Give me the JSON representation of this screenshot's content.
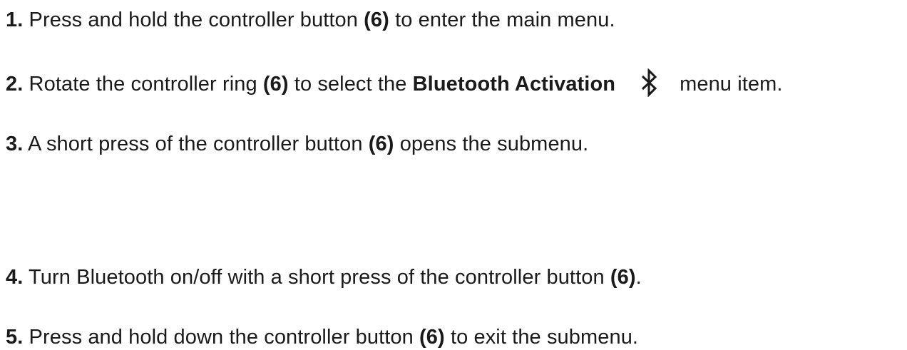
{
  "steps": [
    {
      "number": "1.",
      "t1": " Press and hold the controller button ",
      "ref": "(6)",
      "t2": " to enter the main menu."
    },
    {
      "number": "2.",
      "t1": " Rotate the controller ring ",
      "ref": "(6)",
      "t2": " to select the ",
      "item": "Bluetooth Activation",
      "icon": "bluetooth-icon",
      "t3": "menu item."
    },
    {
      "number": "3.",
      "t1": " A short press of the controller button ",
      "ref": "(6)",
      "t2": " opens the submenu."
    },
    {
      "number": "4.",
      "t1": " Turn Bluetooth on/off with a short press of the controller button ",
      "ref": "(6)",
      "t2": "."
    },
    {
      "number": "5.",
      "t1": " Press and hold down the controller button ",
      "ref": "(6)",
      "t2": " to exit the submenu."
    }
  ]
}
